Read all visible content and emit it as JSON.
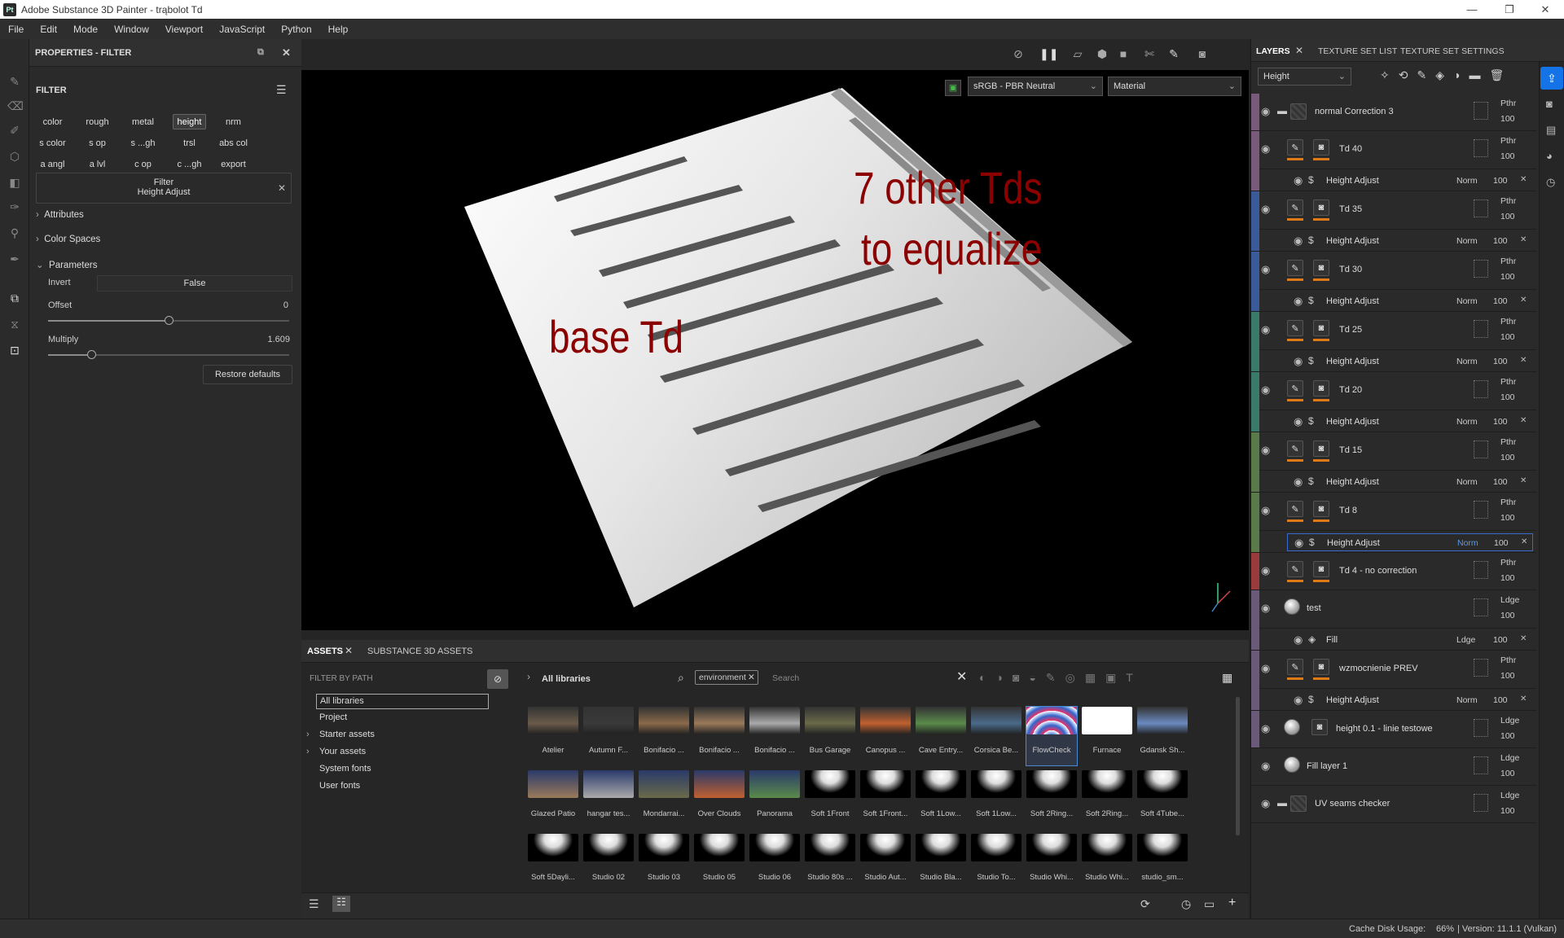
{
  "window": {
    "app_icon": "Pt",
    "title": "Adobe Substance 3D Painter - trąbolot Td",
    "controls": [
      "minimize-icon",
      "restore-icon",
      "close-icon"
    ]
  },
  "menu": [
    "File",
    "Edit",
    "Mode",
    "Window",
    "Viewport",
    "JavaScript",
    "Python",
    "Help"
  ],
  "properties": {
    "header": "PROPERTIES - FILTER",
    "section_title": "FILTER",
    "channels": [
      "color",
      "rough",
      "metal",
      "height",
      "nrm",
      "s color",
      "s op",
      "s ...gh",
      "trsl",
      "abs col",
      "a angl",
      "a lvl",
      "c op",
      "c ...gh",
      "export"
    ],
    "selected_channel": "height",
    "filter_label": "Filter",
    "filter_name": "Height Adjust",
    "sections": {
      "attributes": "Attributes",
      "color_spaces": "Color Spaces",
      "parameters": "Parameters"
    },
    "params": {
      "invert_label": "Invert",
      "invert_value": "False",
      "offset_label": "Offset",
      "offset_value": "0",
      "multiply_label": "Multiply",
      "multiply_value": "1.609",
      "offset_fraction": 0.5,
      "multiply_fraction": 0.18
    },
    "restore": "Restore defaults"
  },
  "viewport": {
    "colorspace": "sRGB - PBR Neutral",
    "display_mode": "Material",
    "annotations": {
      "right_line1": "7 other Tds",
      "right_line2": "to equalize",
      "left": "base Td"
    },
    "annotation_color": "#8b0000"
  },
  "assets": {
    "tabs": [
      "ASSETS",
      "SUBSTANCE 3D ASSETS"
    ],
    "filter_by_path": "FILTER BY PATH",
    "tree": [
      "All libraries",
      "Project",
      "Starter assets",
      "Your assets",
      "System fonts",
      "User fonts"
    ],
    "breadcrumb": "All libraries",
    "search_tag": "environment",
    "search_placeholder": "Search",
    "items": [
      [
        "Atelier",
        "Autumn F...",
        "Bonifacio ...",
        "Bonifacio ...",
        "Bonifacio ...",
        "Bus Garage",
        "Canopus ...",
        "Cave Entry...",
        "Corsica Be...",
        "FlowCheck",
        "Furnace",
        "Gdansk Sh..."
      ],
      [
        "Glazed Patio",
        "hangar tes...",
        "Mondarrai...",
        "Over Clouds",
        "Panorama",
        "Soft 1Front",
        "Soft 1Front...",
        "Soft 1Low...",
        "Soft 1Low...",
        "Soft 2Ring...",
        "Soft 2Ring...",
        "Soft 4Tube..."
      ],
      [
        "Soft 5Dayli...",
        "Studio 02",
        "Studio 03",
        "Studio 05",
        "Studio 06",
        "Studio 80s ...",
        "Studio Aut...",
        "Studio Bla...",
        "Studio To...",
        "Studio Whi...",
        "Studio Whi...",
        "studio_sm..."
      ]
    ],
    "selected_item": "FlowCheck"
  },
  "layers_panel": {
    "tabs": [
      "LAYERS",
      "TEXTURE SET LIST",
      "TEXTURE SET SETTINGS"
    ],
    "channel": "Height",
    "layers": [
      {
        "name": "normal Correction 3",
        "type": "folder",
        "blend": "Pthr",
        "opacity": "100",
        "color": "#7a5a7a"
      },
      {
        "name": "Td 40",
        "type": "paint",
        "blend": "Pthr",
        "opacity": "100",
        "color": "#7a5a7a",
        "effect": "Height Adjust",
        "eblend": "Norm",
        "eopacity": "100"
      },
      {
        "name": "Td 35",
        "type": "paint",
        "blend": "Pthr",
        "opacity": "100",
        "color": "#3a5a99",
        "effect": "Height Adjust",
        "eblend": "Norm",
        "eopacity": "100"
      },
      {
        "name": "Td 30",
        "type": "paint",
        "blend": "Pthr",
        "opacity": "100",
        "color": "#3a5a99",
        "effect": "Height Adjust",
        "eblend": "Norm",
        "eopacity": "100"
      },
      {
        "name": "Td 25",
        "type": "paint",
        "blend": "Pthr",
        "opacity": "100",
        "color": "#3a7a6a",
        "effect": "Height Adjust",
        "eblend": "Norm",
        "eopacity": "100"
      },
      {
        "name": "Td 20",
        "type": "paint",
        "blend": "Pthr",
        "opacity": "100",
        "color": "#3a7a6a",
        "effect": "Height Adjust",
        "eblend": "Norm",
        "eopacity": "100"
      },
      {
        "name": "Td 15",
        "type": "paint",
        "blend": "Pthr",
        "opacity": "100",
        "color": "#5a7a4a",
        "effect": "Height Adjust",
        "eblend": "Norm",
        "eopacity": "100"
      },
      {
        "name": "Td 8",
        "type": "paint",
        "blend": "Pthr",
        "opacity": "100",
        "color": "#5a7a4a",
        "effect": "Height Adjust",
        "eblend": "Norm",
        "eopacity": "100"
      },
      {
        "name": "Td 4 - no correction",
        "type": "paint",
        "blend": "Pthr",
        "opacity": "100",
        "color": "#9a3a3a"
      },
      {
        "name": "test",
        "type": "fill",
        "blend": "Ldge",
        "opacity": "100",
        "color": "#6a5a7a",
        "effect": "Fill",
        "eblend": "Ldge",
        "eopacity": "100"
      },
      {
        "name": "wzmocnienie PREV",
        "type": "paint",
        "blend": "Pthr",
        "opacity": "100",
        "color": "#6a5a7a",
        "effect": "Height Adjust",
        "eblend": "Norm",
        "eopacity": "100"
      },
      {
        "name": "height 0.1 - linie testowe",
        "type": "fill",
        "blend": "Ldge",
        "opacity": "100",
        "color": "#6a5a7a"
      },
      {
        "name": "Fill layer 1",
        "type": "fill",
        "blend": "Ldge",
        "opacity": "100",
        "color": "#2a2a2a"
      },
      {
        "name": "UV seams checker",
        "type": "folder",
        "blend": "Ldge",
        "opacity": "100",
        "color": "#2a2a2a"
      }
    ]
  },
  "status": {
    "cache": "Cache Disk Usage:",
    "cache_value": "66%",
    "version": "| Version: 11.1.1 (Vulkan)"
  }
}
